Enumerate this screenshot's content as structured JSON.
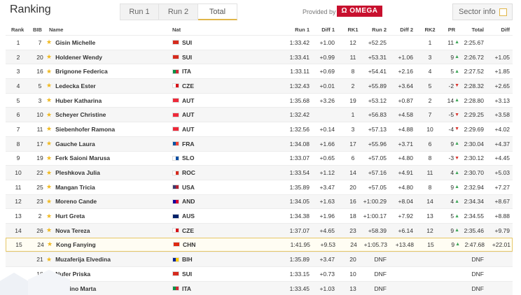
{
  "header": {
    "title": "Ranking",
    "tabs": [
      {
        "label": "Run 1"
      },
      {
        "label": "Run 2"
      },
      {
        "label": "Total"
      }
    ],
    "provided_by": "Provided by",
    "sponsor": "OMEGA",
    "sector_info": "Sector info"
  },
  "columns": {
    "rank": "Rank",
    "bib": "BIB",
    "name": "Name",
    "nat": "Nat",
    "run1": "Run 1",
    "diff1": "Diff 1",
    "rk1": "RK1",
    "run2": "Run 2",
    "diff2": "Diff 2",
    "rk2": "RK2",
    "pr": "PR",
    "total": "Total",
    "diff": "Diff"
  },
  "rows": [
    {
      "rank": "1",
      "bib": "7",
      "name": "Gisin Michelle",
      "nat": "SUI",
      "run1": "1:33.42",
      "diff1": "+1.00",
      "rk1": "12",
      "run2": "+52.25",
      "diff2": "",
      "rk2": "1",
      "pr": "11",
      "trend": "up",
      "total": "2:25.67",
      "diff": ""
    },
    {
      "rank": "2",
      "bib": "20",
      "name": "Holdener Wendy",
      "nat": "SUI",
      "run1": "1:33.41",
      "diff1": "+0.99",
      "rk1": "11",
      "run2": "+53.31",
      "diff2": "+1.06",
      "rk2": "3",
      "pr": "9",
      "trend": "up",
      "total": "2:26.72",
      "diff": "+1.05"
    },
    {
      "rank": "3",
      "bib": "16",
      "name": "Brignone Federica",
      "nat": "ITA",
      "run1": "1:33.11",
      "diff1": "+0.69",
      "rk1": "8",
      "run2": "+54.41",
      "diff2": "+2.16",
      "rk2": "4",
      "pr": "5",
      "trend": "up",
      "total": "2:27.52",
      "diff": "+1.85"
    },
    {
      "rank": "4",
      "bib": "5",
      "name": "Ledecka Ester",
      "nat": "CZE",
      "run1": "1:32.43",
      "diff1": "+0.01",
      "rk1": "2",
      "run2": "+55.89",
      "diff2": "+3.64",
      "rk2": "5",
      "pr": "-2",
      "trend": "down",
      "total": "2:28.32",
      "diff": "+2.65"
    },
    {
      "rank": "5",
      "bib": "3",
      "name": "Huber Katharina",
      "nat": "AUT",
      "run1": "1:35.68",
      "diff1": "+3.26",
      "rk1": "19",
      "run2": "+53.12",
      "diff2": "+0.87",
      "rk2": "2",
      "pr": "14",
      "trend": "up",
      "total": "2:28.80",
      "diff": "+3.13"
    },
    {
      "rank": "6",
      "bib": "10",
      "name": "Scheyer Christine",
      "nat": "AUT",
      "run1": "1:32.42",
      "diff1": "",
      "rk1": "1",
      "run2": "+56.83",
      "diff2": "+4.58",
      "rk2": "7",
      "pr": "-5",
      "trend": "down",
      "total": "2:29.25",
      "diff": "+3.58"
    },
    {
      "rank": "7",
      "bib": "11",
      "name": "Siebenhofer Ramona",
      "nat": "AUT",
      "run1": "1:32.56",
      "diff1": "+0.14",
      "rk1": "3",
      "run2": "+57.13",
      "diff2": "+4.88",
      "rk2": "10",
      "pr": "-4",
      "trend": "down",
      "total": "2:29.69",
      "diff": "+4.02"
    },
    {
      "rank": "8",
      "bib": "17",
      "name": "Gauche Laura",
      "nat": "FRA",
      "run1": "1:34.08",
      "diff1": "+1.66",
      "rk1": "17",
      "run2": "+55.96",
      "diff2": "+3.71",
      "rk2": "6",
      "pr": "9",
      "trend": "up",
      "total": "2:30.04",
      "diff": "+4.37"
    },
    {
      "rank": "9",
      "bib": "19",
      "name": "Ferk Saioni Marusa",
      "nat": "SLO",
      "run1": "1:33.07",
      "diff1": "+0.65",
      "rk1": "6",
      "run2": "+57.05",
      "diff2": "+4.80",
      "rk2": "8",
      "pr": "-3",
      "trend": "down",
      "total": "2:30.12",
      "diff": "+4.45"
    },
    {
      "rank": "10",
      "bib": "22",
      "name": "Pleshkova Julia",
      "nat": "ROC",
      "run1": "1:33.54",
      "diff1": "+1.12",
      "rk1": "14",
      "run2": "+57.16",
      "diff2": "+4.91",
      "rk2": "11",
      "pr": "4",
      "trend": "up",
      "total": "2:30.70",
      "diff": "+5.03"
    },
    {
      "rank": "11",
      "bib": "25",
      "name": "Mangan Tricia",
      "nat": "USA",
      "run1": "1:35.89",
      "diff1": "+3.47",
      "rk1": "20",
      "run2": "+57.05",
      "diff2": "+4.80",
      "rk2": "8",
      "pr": "9",
      "trend": "up",
      "total": "2:32.94",
      "diff": "+7.27"
    },
    {
      "rank": "12",
      "bib": "23",
      "name": "Moreno Cande",
      "nat": "AND",
      "run1": "1:34.05",
      "diff1": "+1.63",
      "rk1": "16",
      "run2": "+1:00.29",
      "diff2": "+8.04",
      "rk2": "14",
      "pr": "4",
      "trend": "up",
      "total": "2:34.34",
      "diff": "+8.67"
    },
    {
      "rank": "13",
      "bib": "2",
      "name": "Hurt Greta",
      "nat": "AUS",
      "run1": "1:34.38",
      "diff1": "+1.96",
      "rk1": "18",
      "run2": "+1:00.17",
      "diff2": "+7.92",
      "rk2": "13",
      "pr": "5",
      "trend": "up",
      "total": "2:34.55",
      "diff": "+8.88"
    },
    {
      "rank": "14",
      "bib": "26",
      "name": "Nova Tereza",
      "nat": "CZE",
      "run1": "1:37.07",
      "diff1": "+4.65",
      "rk1": "23",
      "run2": "+58.39",
      "diff2": "+6.14",
      "rk2": "12",
      "pr": "9",
      "trend": "up",
      "total": "2:35.46",
      "diff": "+9.79"
    },
    {
      "rank": "15",
      "bib": "24",
      "name": "Kong Fanying",
      "nat": "CHN",
      "run1": "1:41.95",
      "diff1": "+9.53",
      "rk1": "24",
      "run2": "+1:05.73",
      "diff2": "+13.48",
      "rk2": "15",
      "pr": "9",
      "trend": "up",
      "total": "2:47.68",
      "diff": "+22.01",
      "highlight": true
    },
    {
      "rank": "",
      "bib": "21",
      "name": "Muzaferija Elvedina",
      "nat": "BIH",
      "run1": "1:35.89",
      "diff1": "+3.47",
      "rk1": "20",
      "run2": "DNF",
      "diff2": "",
      "rk2": "",
      "pr": "",
      "trend": "",
      "total": "DNF",
      "diff": ""
    },
    {
      "rank": "",
      "bib": "18",
      "name": "Nufer Priska",
      "nat": "SUI",
      "run1": "1:33.15",
      "diff1": "+0.73",
      "rk1": "10",
      "run2": "DNF",
      "diff2": "",
      "rk2": "",
      "pr": "",
      "trend": "",
      "total": "DNF",
      "diff": ""
    },
    {
      "rank": "",
      "bib": "15",
      "name": "Bassino Marta",
      "nat": "ITA",
      "run1": "1:33.45",
      "diff1": "+1.03",
      "rk1": "13",
      "run2": "DNF",
      "diff2": "",
      "rk2": "",
      "pr": "",
      "trend": "",
      "total": "DNF",
      "diff": ""
    }
  ],
  "flags": {
    "SUI": [
      "#d52b1e",
      "#d52b1e"
    ],
    "ITA": [
      "#009246",
      "#ce2b37"
    ],
    "CZE": [
      "#ffffff",
      "#d7141a"
    ],
    "AUT": [
      "#ed2939",
      "#ed2939"
    ],
    "FRA": [
      "#0055a4",
      "#ef4135"
    ],
    "SLO": [
      "#ffffff",
      "#0b4ea2"
    ],
    "ROC": [
      "#ffffff",
      "#d52b1e"
    ],
    "USA": [
      "#3c3b6e",
      "#b22234"
    ],
    "AND": [
      "#10069f",
      "#d50032"
    ],
    "AUS": [
      "#012169",
      "#012169"
    ],
    "CHN": [
      "#de2910",
      "#de2910"
    ],
    "BIH": [
      "#002395",
      "#fecb00"
    ]
  }
}
